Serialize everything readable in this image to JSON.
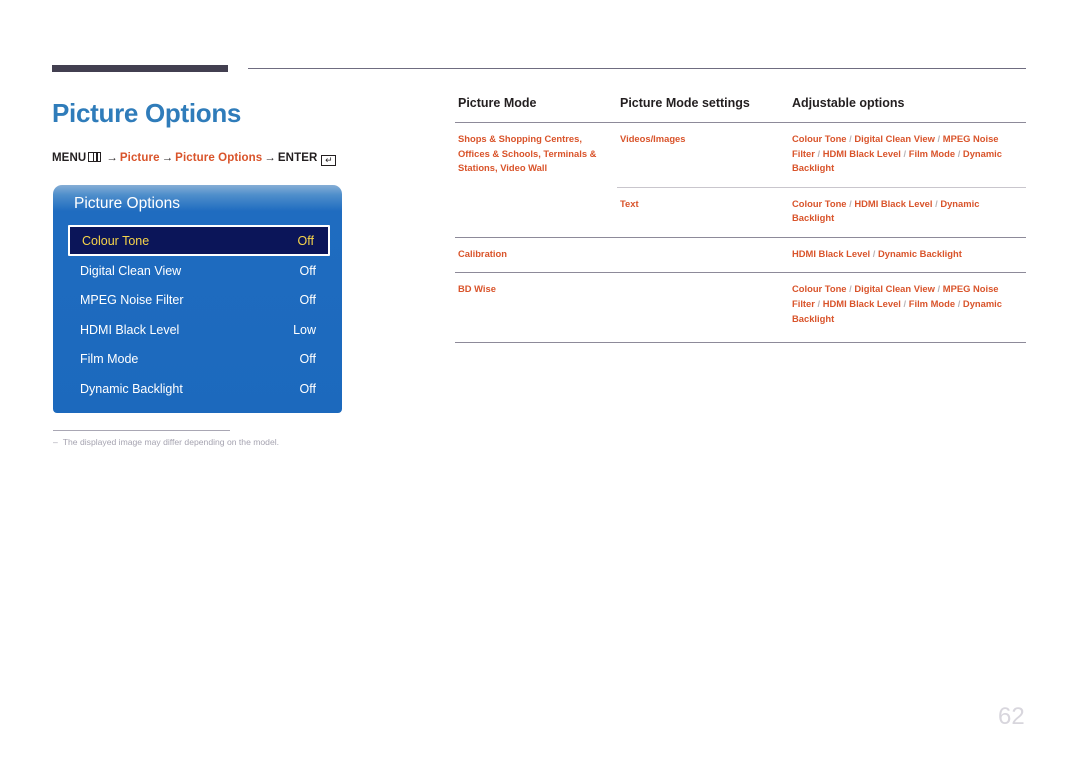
{
  "page": {
    "title": "Picture Options",
    "number": "62"
  },
  "breadcrumb": {
    "menu_label": "MENU",
    "menu_icon": "menu-grid-icon",
    "arrow": "→",
    "step1": "Picture",
    "step2": "Picture Options",
    "enter_label": "ENTER",
    "enter_icon": "enter-key-icon"
  },
  "osd": {
    "title": "Picture Options",
    "items": [
      {
        "label": "Colour Tone",
        "value": "Off",
        "selected": true
      },
      {
        "label": "Digital Clean View",
        "value": "Off",
        "selected": false
      },
      {
        "label": "MPEG Noise Filter",
        "value": "Off",
        "selected": false
      },
      {
        "label": "HDMI Black Level",
        "value": "Low",
        "selected": false
      },
      {
        "label": "Film Mode",
        "value": "Off",
        "selected": false
      },
      {
        "label": "Dynamic Backlight",
        "value": "Off",
        "selected": false
      }
    ],
    "colors": {
      "panel_blue": "#1c69bd",
      "panel_top_blue": "#86aed6",
      "selected_bg": "#0b1559",
      "selected_text": "#f6d44a"
    }
  },
  "footnote": {
    "dash": "–",
    "text": "The displayed image may differ depending on the model."
  },
  "table": {
    "headers": {
      "col1": "Picture Mode",
      "col2": "Picture Mode settings",
      "col3": "Adjustable options"
    },
    "rows": [
      {
        "mode": "Shops & Shopping Centres, Offices & Schools, Terminals & Stations, Video Wall",
        "setting": "Videos/Images",
        "options": "Colour Tone / Digital Clean View / MPEG Noise Filter / HDMI Black Level / Film Mode / Dynamic Backlight"
      },
      {
        "mode": "",
        "setting": "Text",
        "options": "Colour Tone / HDMI Black Level / Dynamic Backlight"
      },
      {
        "mode": "Calibration",
        "setting": "",
        "options": "HDMI Black Level / Dynamic Backlight"
      },
      {
        "mode": "BD Wise",
        "setting": "",
        "options": "Colour Tone / Digital Clean View / MPEG Noise Filter / HDMI Black Level / Film Mode / Dynamic Backlight"
      }
    ]
  },
  "colors": {
    "accent_orange": "#d9542b",
    "title_blue": "#2f7cba",
    "rule_dark": "#423f50"
  }
}
